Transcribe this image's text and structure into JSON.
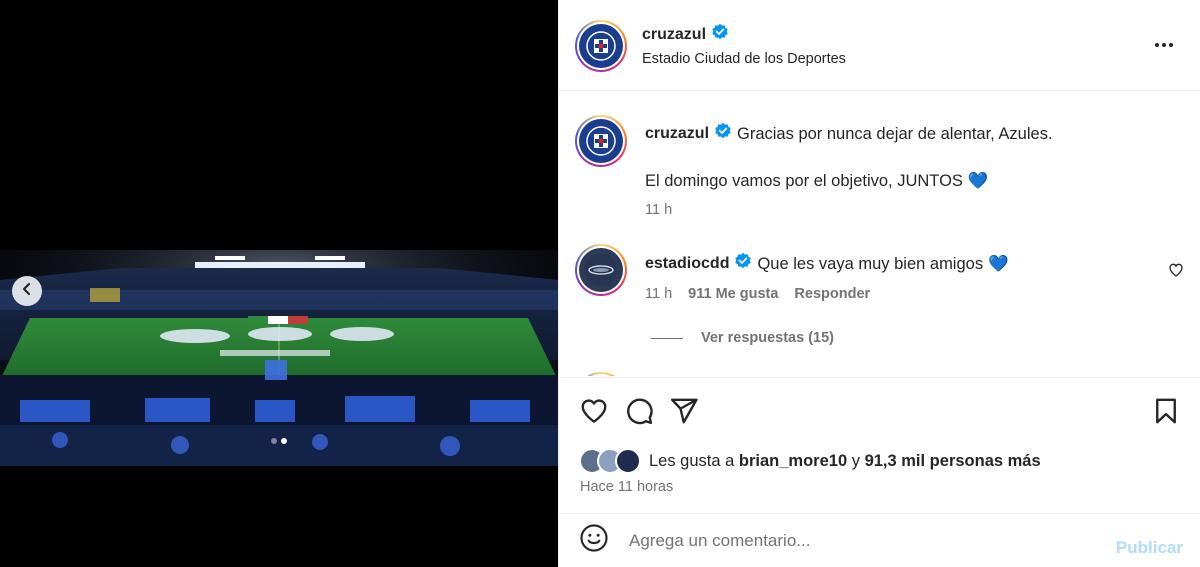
{
  "post": {
    "author": "cruzazul",
    "location": "Estadio Ciudad de los Deportes"
  },
  "caption": {
    "author": "cruzazul",
    "line1": "Gracias por nunca dejar de alentar, Azules.",
    "line2": "El domingo vamos por el objetivo, JUNTOS",
    "emoji": "💙",
    "time": "11 h"
  },
  "comment": {
    "author": "estadiocdd",
    "text": "Que les vaya muy bien amigos",
    "emoji": "💙",
    "time": "11 h",
    "likes": "911 Me gusta",
    "reply": "Responder",
    "view_replies": "Ver respuestas (15)"
  },
  "likes": {
    "prefix": "Les gusta a",
    "user": "brian_more10",
    "middle": "y",
    "count": "91,3 mil personas más"
  },
  "timestamp": "Hace 11 horas",
  "add_comment": {
    "placeholder": "Agrega un comentario...",
    "publish": "Publicar"
  },
  "carousel": {
    "slides": 2,
    "active_index": 1
  },
  "icons": {
    "more": "more-horizontal-icon",
    "like": "heart-outline-icon",
    "comment": "comment-bubble-icon",
    "share": "paper-plane-icon",
    "save": "bookmark-icon",
    "emoji": "smiley-face-icon",
    "prev": "chevron-left-icon"
  },
  "colors": {
    "verified": "#0095f6",
    "publish_disabled": "#b3dbff",
    "heart_emoji": "#3b82f6",
    "club_blue": "#1b3d8f"
  }
}
